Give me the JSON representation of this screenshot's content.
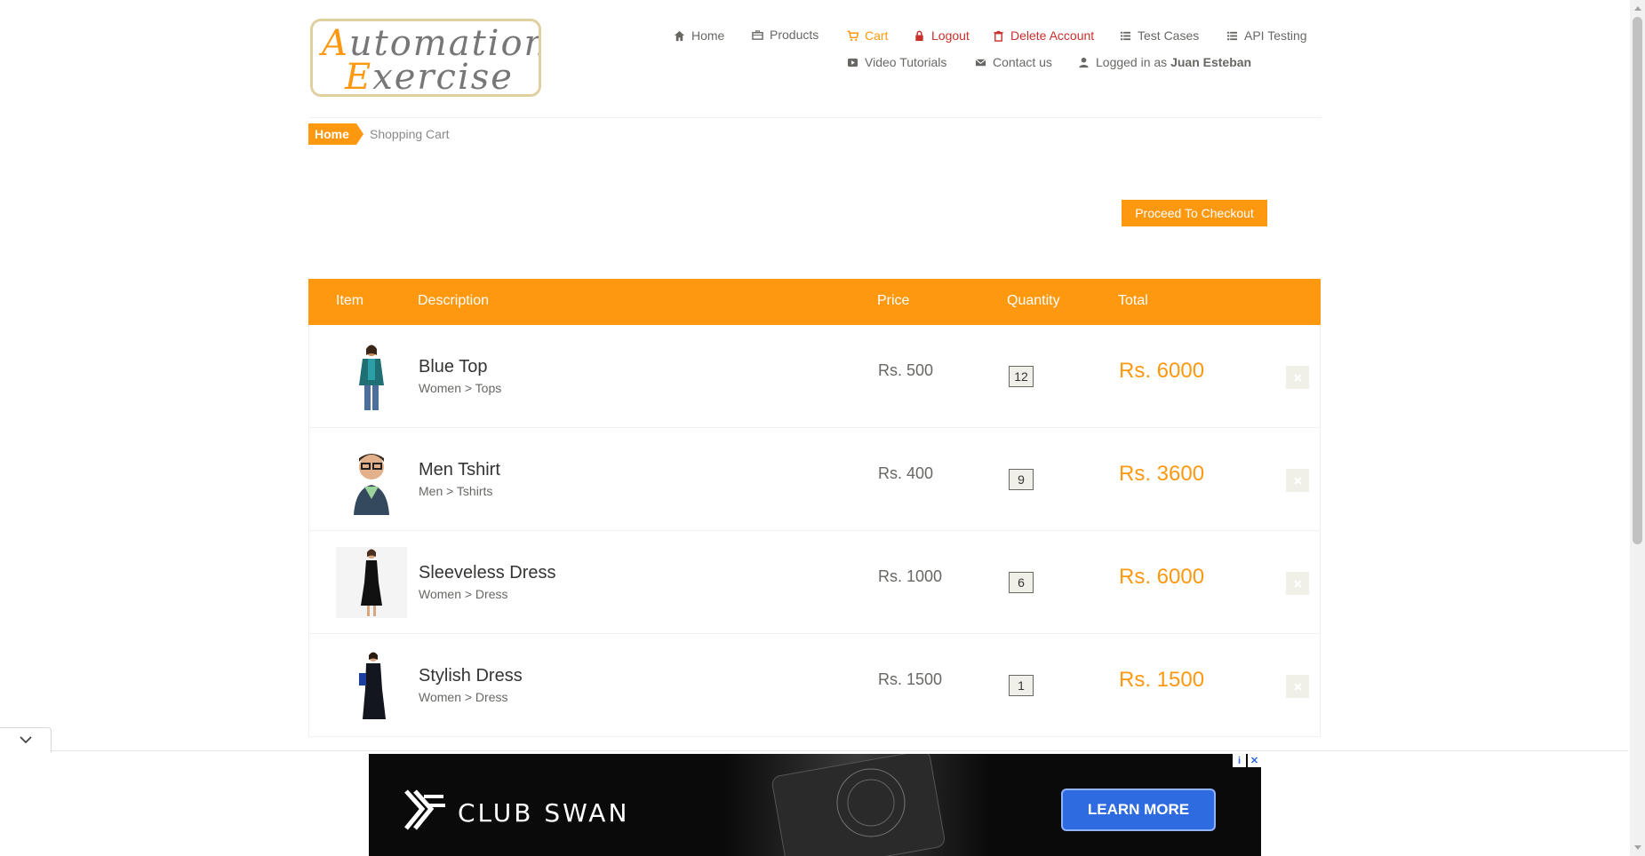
{
  "logo": {
    "line1_cap": "A",
    "line1_rest": "utomation",
    "line2_cap": "E",
    "line2_rest": "xercise"
  },
  "nav": {
    "home": "Home",
    "products": "Products",
    "cart": "Cart",
    "logout": "Logout",
    "delete_account": "Delete Account",
    "test_cases": "Test Cases",
    "api_testing": "API Testing",
    "video_tutorials": "Video Tutorials",
    "contact_us": "Contact us",
    "logged_in_prefix": "Logged in as",
    "logged_in_user": "Juan Esteban"
  },
  "breadcrumb": {
    "home": "Home",
    "current": "Shopping Cart"
  },
  "checkout_label": "Proceed To Checkout",
  "table": {
    "headers": {
      "item": "Item",
      "description": "Description",
      "price": "Price",
      "quantity": "Quantity",
      "total": "Total"
    },
    "rows": [
      {
        "name": "Blue Top",
        "category": "Women > Tops",
        "price": "Rs. 500",
        "quantity": "12",
        "total": "Rs. 6000"
      },
      {
        "name": "Men Tshirt",
        "category": "Men > Tshirts",
        "price": "Rs. 400",
        "quantity": "9",
        "total": "Rs. 3600"
      },
      {
        "name": "Sleeveless Dress",
        "category": "Women > Dress",
        "price": "Rs. 1000",
        "quantity": "6",
        "total": "Rs. 6000"
      },
      {
        "name": "Stylish Dress",
        "category": "Women > Dress",
        "price": "Rs. 1500",
        "quantity": "1",
        "total": "Rs. 1500"
      }
    ]
  },
  "ad": {
    "brand": "CLUB SWAN",
    "cta": "LEARN MORE"
  },
  "colors": {
    "accent": "#fe980f",
    "danger": "#c9302c",
    "text": "#696763",
    "ad_button": "#2f6be0"
  },
  "icons": {
    "home": "home-icon",
    "products": "briefcase-icon",
    "cart": "cart-icon",
    "logout": "lock-icon",
    "delete": "trash-icon",
    "test_cases": "list-icon",
    "api": "list-icon",
    "video": "video-icon",
    "contact": "envelope-icon",
    "user": "user-icon",
    "remove": "close-icon"
  }
}
